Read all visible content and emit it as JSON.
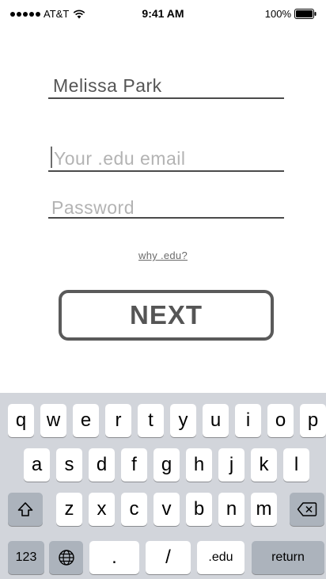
{
  "status_bar": {
    "carrier": "AT&T",
    "time": "9:41 AM",
    "battery": "100%"
  },
  "form": {
    "name_value": "Melissa Park",
    "email_placeholder": "Your .edu email",
    "password_placeholder": "Password",
    "why_link": "why .edu?",
    "next_label": "NEXT"
  },
  "keyboard": {
    "row1": [
      "q",
      "w",
      "e",
      "r",
      "t",
      "y",
      "u",
      "i",
      "o",
      "p"
    ],
    "row2": [
      "a",
      "s",
      "d",
      "f",
      "g",
      "h",
      "j",
      "k",
      "l"
    ],
    "row3": [
      "z",
      "x",
      "c",
      "v",
      "b",
      "n",
      "m"
    ],
    "numbers_label": "123",
    "dot_label": ".",
    "slash_label": "/",
    "edu_label": ".edu",
    "return_label": "return"
  },
  "icons": {
    "wifi": "wifi-icon",
    "battery": "battery-icon",
    "shift": "shift-icon",
    "delete": "delete-icon",
    "globe": "globe-icon"
  }
}
